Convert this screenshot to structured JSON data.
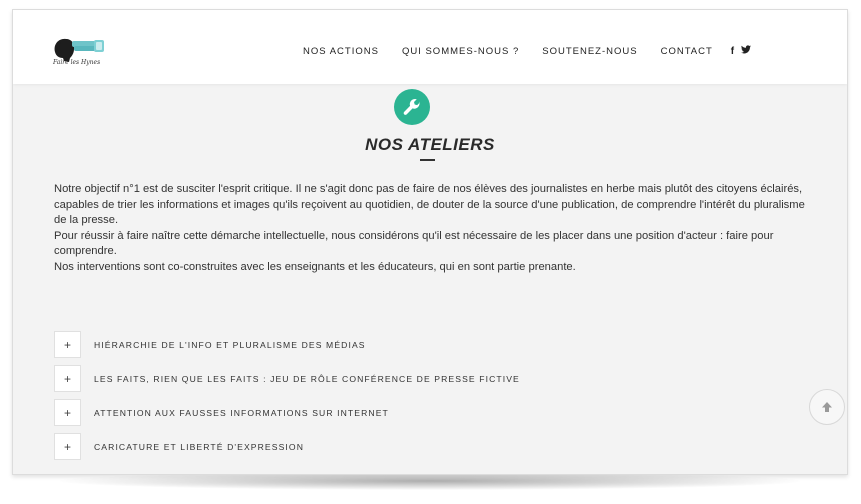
{
  "header": {
    "logo_text": "Faire les Hynes",
    "nav": [
      {
        "label": "NOS ACTIONS"
      },
      {
        "label": "QUI SOMMES-NOUS ?"
      },
      {
        "label": "SOUTENEZ-NOUS"
      },
      {
        "label": "CONTACT"
      }
    ],
    "social": {
      "facebook": "f",
      "twitter": "♥"
    }
  },
  "section": {
    "icon": "wrench-icon",
    "title": "NOS ATELIERS",
    "accent_color": "#2bb492"
  },
  "intro": {
    "paragraphs": [
      "Notre objectif n°1 est de susciter l'esprit critique. Il ne s'agit donc pas de faire de nos élèves des journalistes en herbe mais plutôt des citoyens éclairés, capables de trier les informations et images qu'ils reçoivent au quotidien, de douter de la source d'une publication, de comprendre l'intérêt du pluralisme de la presse.",
      "Pour réussir à faire naître cette démarche intellectuelle, nous considérons qu'il est nécessaire de les placer dans une position d'acteur : faire pour comprendre.",
      "Nos interventions sont co-construites avec les enseignants et les éducateurs, qui en sont partie prenante."
    ]
  },
  "accordion": {
    "toggle_symbol": "+",
    "items": [
      {
        "label": "HIÉRARCHIE DE L'INFO ET PLURALISME DES MÉDIAS"
      },
      {
        "label": "LES FAITS, RIEN QUE LES FAITS : JEU DE RÔLE CONFÉRENCE DE PRESSE FICTIVE"
      },
      {
        "label": "ATTENTION AUX FAUSSES INFORMATIONS SUR INTERNET"
      },
      {
        "label": "CARICATURE ET LIBERTÉ D'EXPRESSION"
      }
    ]
  },
  "scroll_top": {
    "icon": "arrow-up-icon"
  }
}
